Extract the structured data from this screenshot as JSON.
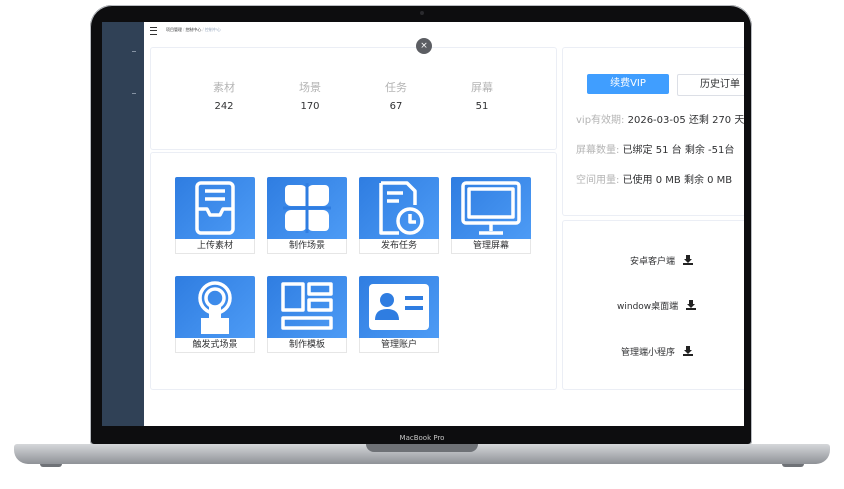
{
  "device": {
    "label": "MacBook Pro"
  },
  "breadcrumb": {
    "items": [
      "项目管理",
      "控制中心",
      "控制中心"
    ]
  },
  "stats": [
    {
      "label": "素材",
      "value": "242"
    },
    {
      "label": "场景",
      "value": "170"
    },
    {
      "label": "任务",
      "value": "67"
    },
    {
      "label": "屏幕",
      "value": "51"
    }
  ],
  "close": {
    "glyph": "×"
  },
  "actions": [
    {
      "label": "上传素材",
      "icon": "inbox-tray-icon"
    },
    {
      "label": "制作场景",
      "icon": "clover-icon"
    },
    {
      "label": "发布任务",
      "icon": "clock-document-icon"
    },
    {
      "label": "管理屏幕",
      "icon": "monitor-icon"
    },
    {
      "label": "触发式场景",
      "icon": "touch-hand-icon"
    },
    {
      "label": "制作模板",
      "icon": "template-layout-icon"
    },
    {
      "label": "管理账户",
      "icon": "id-card-icon"
    }
  ],
  "vip": {
    "renew_label": "续费VIP",
    "history_label": "历史订单",
    "validity_key": "vip有效期:",
    "validity_value": "2026-03-05 还剩 270 天",
    "screens_key": "屏幕数量:",
    "screens_value": "已绑定 51 台 剩余 -51台",
    "storage_key": "空间用量:",
    "storage_value": "已使用 0 MB 剩余 0 MB"
  },
  "downloads": [
    {
      "label": "安卓客户端",
      "icon": "download-icon"
    },
    {
      "label": "window桌面端",
      "icon": "download-icon"
    },
    {
      "label": "管理端小程序",
      "icon": "download-icon"
    }
  ],
  "colors": {
    "sidebar": "#304156",
    "accent": "#409eff",
    "tile": "#2f7de1"
  }
}
